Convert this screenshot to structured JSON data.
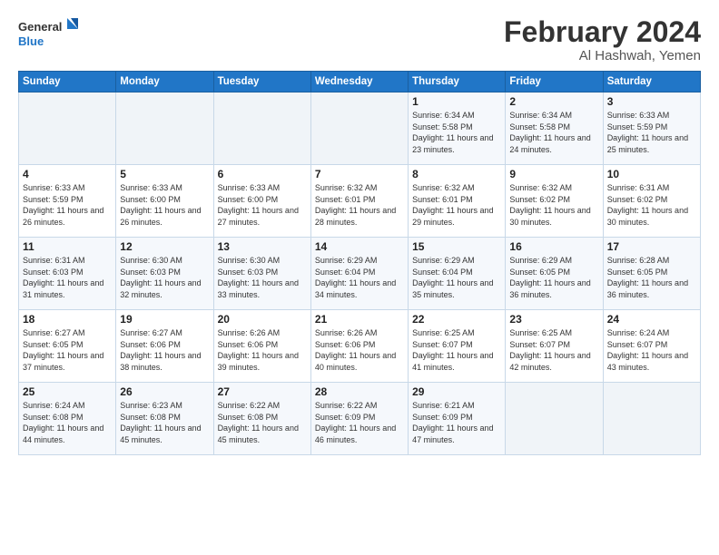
{
  "logo": {
    "general": "General",
    "blue": "Blue"
  },
  "title": "February 2024",
  "location": "Al Hashwah, Yemen",
  "headers": [
    "Sunday",
    "Monday",
    "Tuesday",
    "Wednesday",
    "Thursday",
    "Friday",
    "Saturday"
  ],
  "weeks": [
    [
      {
        "day": "",
        "info": ""
      },
      {
        "day": "",
        "info": ""
      },
      {
        "day": "",
        "info": ""
      },
      {
        "day": "",
        "info": ""
      },
      {
        "day": "1",
        "info": "Sunrise: 6:34 AM\nSunset: 5:58 PM\nDaylight: 11 hours and 23 minutes."
      },
      {
        "day": "2",
        "info": "Sunrise: 6:34 AM\nSunset: 5:58 PM\nDaylight: 11 hours and 24 minutes."
      },
      {
        "day": "3",
        "info": "Sunrise: 6:33 AM\nSunset: 5:59 PM\nDaylight: 11 hours and 25 minutes."
      }
    ],
    [
      {
        "day": "4",
        "info": "Sunrise: 6:33 AM\nSunset: 5:59 PM\nDaylight: 11 hours and 26 minutes."
      },
      {
        "day": "5",
        "info": "Sunrise: 6:33 AM\nSunset: 6:00 PM\nDaylight: 11 hours and 26 minutes."
      },
      {
        "day": "6",
        "info": "Sunrise: 6:33 AM\nSunset: 6:00 PM\nDaylight: 11 hours and 27 minutes."
      },
      {
        "day": "7",
        "info": "Sunrise: 6:32 AM\nSunset: 6:01 PM\nDaylight: 11 hours and 28 minutes."
      },
      {
        "day": "8",
        "info": "Sunrise: 6:32 AM\nSunset: 6:01 PM\nDaylight: 11 hours and 29 minutes."
      },
      {
        "day": "9",
        "info": "Sunrise: 6:32 AM\nSunset: 6:02 PM\nDaylight: 11 hours and 30 minutes."
      },
      {
        "day": "10",
        "info": "Sunrise: 6:31 AM\nSunset: 6:02 PM\nDaylight: 11 hours and 30 minutes."
      }
    ],
    [
      {
        "day": "11",
        "info": "Sunrise: 6:31 AM\nSunset: 6:03 PM\nDaylight: 11 hours and 31 minutes."
      },
      {
        "day": "12",
        "info": "Sunrise: 6:30 AM\nSunset: 6:03 PM\nDaylight: 11 hours and 32 minutes."
      },
      {
        "day": "13",
        "info": "Sunrise: 6:30 AM\nSunset: 6:03 PM\nDaylight: 11 hours and 33 minutes."
      },
      {
        "day": "14",
        "info": "Sunrise: 6:29 AM\nSunset: 6:04 PM\nDaylight: 11 hours and 34 minutes."
      },
      {
        "day": "15",
        "info": "Sunrise: 6:29 AM\nSunset: 6:04 PM\nDaylight: 11 hours and 35 minutes."
      },
      {
        "day": "16",
        "info": "Sunrise: 6:29 AM\nSunset: 6:05 PM\nDaylight: 11 hours and 36 minutes."
      },
      {
        "day": "17",
        "info": "Sunrise: 6:28 AM\nSunset: 6:05 PM\nDaylight: 11 hours and 36 minutes."
      }
    ],
    [
      {
        "day": "18",
        "info": "Sunrise: 6:27 AM\nSunset: 6:05 PM\nDaylight: 11 hours and 37 minutes."
      },
      {
        "day": "19",
        "info": "Sunrise: 6:27 AM\nSunset: 6:06 PM\nDaylight: 11 hours and 38 minutes."
      },
      {
        "day": "20",
        "info": "Sunrise: 6:26 AM\nSunset: 6:06 PM\nDaylight: 11 hours and 39 minutes."
      },
      {
        "day": "21",
        "info": "Sunrise: 6:26 AM\nSunset: 6:06 PM\nDaylight: 11 hours and 40 minutes."
      },
      {
        "day": "22",
        "info": "Sunrise: 6:25 AM\nSunset: 6:07 PM\nDaylight: 11 hours and 41 minutes."
      },
      {
        "day": "23",
        "info": "Sunrise: 6:25 AM\nSunset: 6:07 PM\nDaylight: 11 hours and 42 minutes."
      },
      {
        "day": "24",
        "info": "Sunrise: 6:24 AM\nSunset: 6:07 PM\nDaylight: 11 hours and 43 minutes."
      }
    ],
    [
      {
        "day": "25",
        "info": "Sunrise: 6:24 AM\nSunset: 6:08 PM\nDaylight: 11 hours and 44 minutes."
      },
      {
        "day": "26",
        "info": "Sunrise: 6:23 AM\nSunset: 6:08 PM\nDaylight: 11 hours and 45 minutes."
      },
      {
        "day": "27",
        "info": "Sunrise: 6:22 AM\nSunset: 6:08 PM\nDaylight: 11 hours and 45 minutes."
      },
      {
        "day": "28",
        "info": "Sunrise: 6:22 AM\nSunset: 6:09 PM\nDaylight: 11 hours and 46 minutes."
      },
      {
        "day": "29",
        "info": "Sunrise: 6:21 AM\nSunset: 6:09 PM\nDaylight: 11 hours and 47 minutes."
      },
      {
        "day": "",
        "info": ""
      },
      {
        "day": "",
        "info": ""
      }
    ]
  ]
}
